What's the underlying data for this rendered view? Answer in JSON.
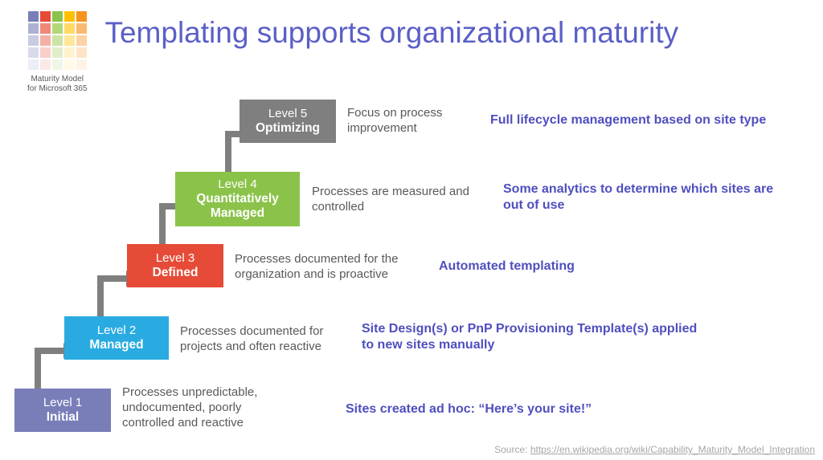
{
  "logo": {
    "caption_line1": "Maturity Model",
    "caption_line2": "for Microsoft 365",
    "cells": [
      "#797db8",
      "#e64b38",
      "#8bc34a",
      "#ffc000",
      "#f7941e",
      "#aeb1d4",
      "#ef8878",
      "#b0d778",
      "#ffd966",
      "#fbb871",
      "#c9cbe2",
      "#f4b0a6",
      "#cce5a6",
      "#ffe699",
      "#fcd2a6",
      "#d9dbec",
      "#f8cfc9",
      "#dfeec9",
      "#fff2cc",
      "#fde4c9",
      "#eceef6",
      "#fbe9e6",
      "#eff6e6",
      "#fff9e6",
      "#fef3e6"
    ]
  },
  "title": "Templating supports organizational maturity",
  "levels": {
    "l5": {
      "box_color": "#7f7f7f",
      "level": "Level 5",
      "name": "Optimizing",
      "desc": "Focus on process improvement",
      "note": "Full lifecycle management based on site type"
    },
    "l4": {
      "box_color": "#8bc34a",
      "level": "Level 4",
      "name": "Quantitatively Managed",
      "desc": "Processes are measured and controlled",
      "note": "Some analytics to determine which sites are out of use"
    },
    "l3": {
      "box_color": "#e64b38",
      "level": "Level 3",
      "name": "Defined",
      "desc": "Processes documented for the organization and is proactive",
      "note": "Automated templating"
    },
    "l2": {
      "box_color": "#29abe2",
      "level": "Level 2",
      "name": "Managed",
      "desc": "Processes documented for projects and often reactive",
      "note": "Site Design(s) or PnP Provisioning Template(s) applied to new sites manually"
    },
    "l1": {
      "box_color": "#797db8",
      "level": "Level 1",
      "name": "Initial",
      "desc": "Processes unpredictable, undocumented, poorly controlled and reactive",
      "note": "Sites created ad hoc: “Here’s your site!”"
    }
  },
  "source": {
    "label": "Source: ",
    "url_text": "https://en.wikipedia.org/wiki/Capability_Maturity_Model_Integration"
  }
}
